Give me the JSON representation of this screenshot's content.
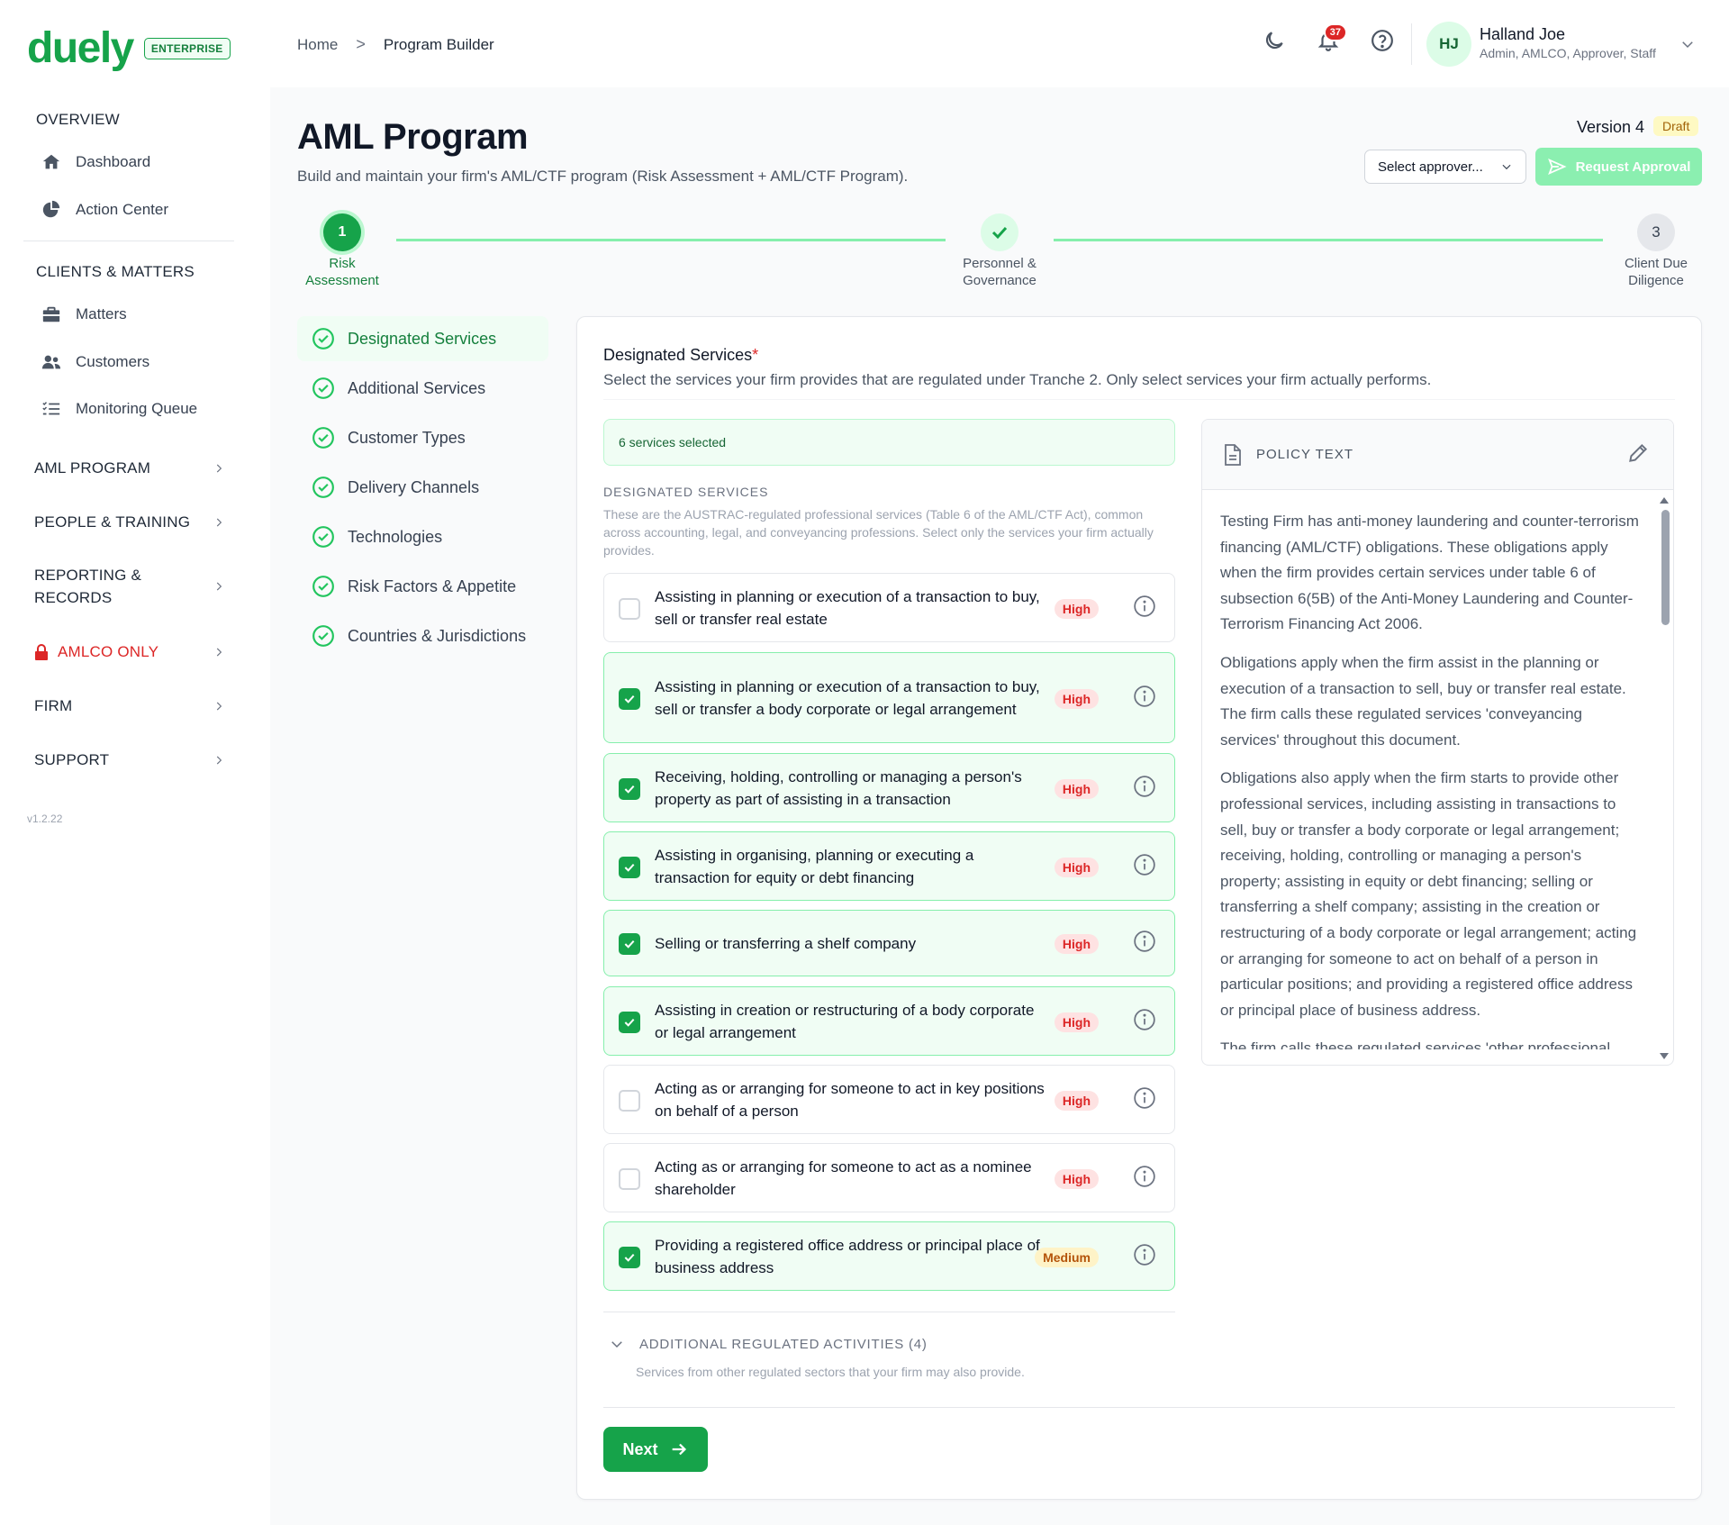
{
  "brand": {
    "name": "duely",
    "tier": "ENTERPRISE"
  },
  "sidebar": {
    "overview_heading": "OVERVIEW",
    "overview_items": [
      {
        "label": "Dashboard",
        "icon": "home-icon"
      },
      {
        "label": "Action Center",
        "icon": "pie-chart-icon"
      }
    ],
    "clients_heading": "CLIENTS & MATTERS",
    "clients_items": [
      {
        "label": "Matters",
        "icon": "briefcase-icon"
      },
      {
        "label": "Customers",
        "icon": "users-icon"
      },
      {
        "label": "Monitoring Queue",
        "icon": "list-check-icon"
      }
    ],
    "groups": [
      {
        "label": "AML PROGRAM"
      },
      {
        "label": "PEOPLE & TRAINING"
      },
      {
        "label": "REPORTING & RECORDS"
      },
      {
        "label": "AMLCO ONLY",
        "icon": "lock-icon",
        "color": "#dc2626"
      },
      {
        "label": "FIRM"
      },
      {
        "label": "SUPPORT"
      }
    ],
    "version": "v1.2.22"
  },
  "header": {
    "breadcrumb": {
      "home": "Home",
      "separator": ">",
      "current": "Program Builder"
    },
    "notifications_count": "37",
    "user": {
      "initials": "HJ",
      "name": "Halland Joe",
      "role": "Admin, AMLCO, Approver, Staff"
    }
  },
  "page": {
    "title": "AML Program",
    "subtitle": "Build and maintain your firm's AML/CTF program (Risk Assessment + AML/CTF Program).",
    "version_label": "Version 4",
    "status": "Draft",
    "approver_placeholder": "Select approver...",
    "request_label": "Request Approval"
  },
  "stepper": {
    "steps": [
      {
        "number": "1",
        "label_line1": "Risk",
        "label_line2": "Assessment",
        "state": "active"
      },
      {
        "number": "",
        "label_line1": "Personnel &",
        "label_line2": "Governance",
        "state": "done"
      },
      {
        "number": "3",
        "label_line1": "Client Due",
        "label_line2": "Diligence",
        "state": "todo"
      }
    ]
  },
  "sections": [
    {
      "label": "Designated Services",
      "active": true
    },
    {
      "label": "Additional Services"
    },
    {
      "label": "Customer Types"
    },
    {
      "label": "Delivery Channels"
    },
    {
      "label": "Technologies"
    },
    {
      "label": "Risk Factors & Appetite"
    },
    {
      "label": "Countries & Jurisdictions"
    }
  ],
  "card": {
    "title": "Designated Services",
    "required_mark": "*",
    "description": "Select the services your firm provides that are regulated under Tranche 2. Only select services your firm actually performs.",
    "selected_text": "6 services selected",
    "list_heading": "DESIGNATED SERVICES",
    "list_description": "These are the AUSTRAC-regulated professional services (Table 6 of the AML/CTF Act), common across accounting, legal, and conveyancing professions. Select only the services your firm actually provides.",
    "services": [
      {
        "label": "Assisting in planning or execution of a transaction to buy, sell or transfer real estate",
        "risk": "High",
        "checked": false
      },
      {
        "label": "Assisting in planning or execution of a transaction to buy, sell or transfer a body corporate or legal arrangement",
        "risk": "High",
        "checked": true
      },
      {
        "label": "Receiving, holding, controlling or managing a person's property as part of assisting in a transaction",
        "risk": "High",
        "checked": true
      },
      {
        "label": "Assisting in organising, planning or executing a transaction for equity or debt financing",
        "risk": "High",
        "checked": true
      },
      {
        "label": "Selling or transferring a shelf company",
        "risk": "High",
        "checked": true
      },
      {
        "label": "Assisting in creation or restructuring of a body corporate or legal arrangement",
        "risk": "High",
        "checked": true
      },
      {
        "label": "Acting as or arranging for someone to act in key positions on behalf of a person",
        "risk": "High",
        "checked": false
      },
      {
        "label": "Acting as or arranging for someone to act as a nominee shareholder",
        "risk": "High",
        "checked": false
      },
      {
        "label": "Providing a registered office address or principal place of business address",
        "risk": "Medium",
        "checked": true
      }
    ],
    "additional_heading": "ADDITIONAL REGULATED ACTIVITIES (4)",
    "additional_description": "Services from other regulated sectors that your firm may also provide.",
    "next_label": "Next"
  },
  "policy": {
    "title": "POLICY TEXT",
    "paragraphs": [
      "Testing Firm has anti-money laundering and counter-terrorism financing (AML/CTF) obligations. These obligations apply when the firm provides certain services under table 6 of subsection 6(5B) of the Anti-Money Laundering and Counter-Terrorism Financing Act 2006.",
      "Obligations apply when the firm assist in the planning or execution of a transaction to sell, buy or transfer real estate. The firm calls these regulated services 'conveyancing services' throughout this document.",
      "Obligations also apply when the firm starts to provide other professional services, including assisting in transactions to sell, buy or transfer a body corporate or legal arrangement; receiving, holding, controlling or managing a person's property; assisting in equity or debt financing; selling or transferring a shelf company; assisting in the creation or restructuring of a body corporate or legal arrangement; acting or arranging for someone to act on behalf of a person in particular positions; and providing a registered office address or principal place of business address.",
      "The firm calls these regulated services 'other professional"
    ]
  },
  "colors": {
    "brand_green": "#16a34a",
    "high_risk": "#dc2626",
    "medium_risk": "#b45309"
  }
}
